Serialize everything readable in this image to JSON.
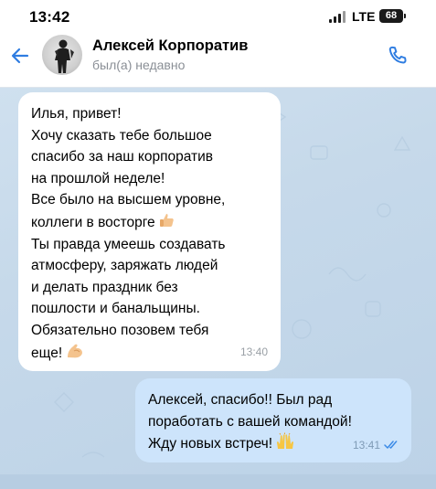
{
  "status_bar": {
    "time": "13:42",
    "network": "LTE",
    "battery": "68"
  },
  "header": {
    "contact_name": "Алексей Корпоратив",
    "contact_status": "был(а) недавно"
  },
  "messages": [
    {
      "direction": "incoming",
      "lines": [
        "Илья, привет!",
        "Хочу сказать тебе большое",
        "спасибо за наш корпоратив",
        "на прошлой неделе!",
        "Все было на высшем уровне,",
        "коллеги в восторге",
        "Ты правда умеешь создавать",
        "атмосферу, заряжать людей",
        "и делать праздник без",
        "пошлости и банальщины.",
        "Обязательно позовем тебя",
        "еще!"
      ],
      "time": "13:40",
      "emojis": [
        "thumbs-up-icon",
        "flexed-biceps-icon"
      ]
    },
    {
      "direction": "outgoing",
      "lines": [
        "Алексей, спасибо!! Был рад",
        "поработать с вашей командой!",
        "Жду новых встреч!"
      ],
      "time": "13:41",
      "read": true,
      "emojis": [
        "raising-hands-icon"
      ]
    }
  ],
  "colors": {
    "accent": "#2f7de1",
    "incoming_bubble": "#ffffff",
    "outgoing_bubble": "#cde4fb",
    "chat_background": "#c9dbec",
    "read_check": "#3b8ae6"
  }
}
